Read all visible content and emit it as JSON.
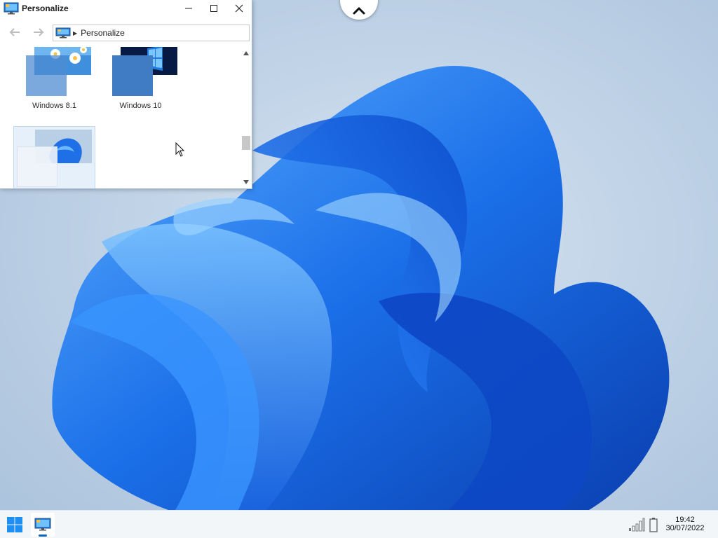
{
  "window": {
    "title": "Personalize",
    "address": "Personalize",
    "items": [
      {
        "label": "Windows 8.1"
      },
      {
        "label": "Windows 10"
      },
      {
        "label": ""
      }
    ]
  },
  "taskbar": {
    "time": "19:42",
    "date": "30/07/2022"
  },
  "icons": {
    "app": "personalize-monitor-icon",
    "back": "back-arrow-icon",
    "forward": "forward-arrow-icon",
    "minimize": "minimize-icon",
    "maximize": "maximize-icon",
    "close": "close-icon",
    "start": "windows-start-icon",
    "signal": "signal-icon",
    "battery": "battery-icon"
  },
  "colors": {
    "accent": "#0a67c8",
    "wallpaper_bloom": "#1565e0"
  }
}
